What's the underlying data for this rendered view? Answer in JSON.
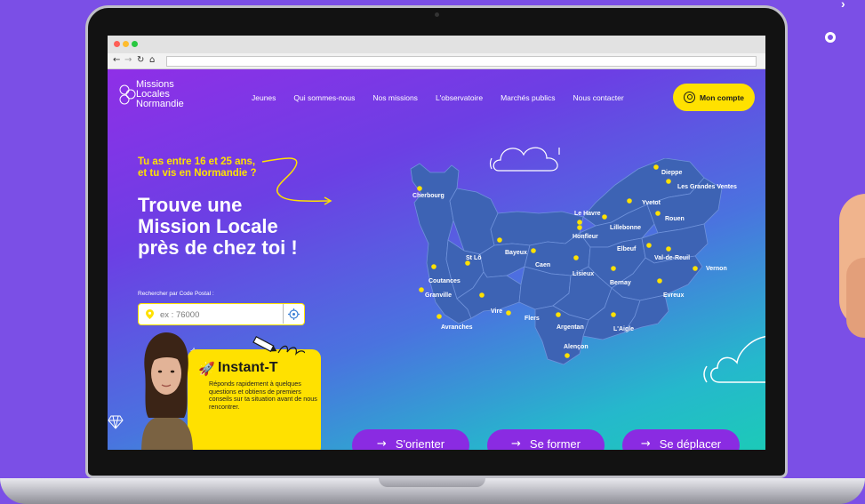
{
  "site": {
    "logo": {
      "lines": [
        "Missions",
        "Locales",
        "Normandie"
      ]
    },
    "menu": [
      "Jeunes",
      "Qui sommes-nous",
      "Nos missions",
      "L'observatoire",
      "Marchés publics",
      "Nous contacter"
    ],
    "account_label": "Mon compte"
  },
  "hero": {
    "intro_lines": [
      "Tu as entre 16 et 25 ans,",
      "et tu vis en Normandie ?"
    ],
    "headline_lines": [
      "Trouve une",
      "Mission Locale",
      "près de chez toi !"
    ]
  },
  "search": {
    "label": "Rechercher par Code Postal :",
    "placeholder": "ex : 76000"
  },
  "instant": {
    "title": "Instant-T",
    "description": "Réponds rapidement à quelques questions et obtiens de premiers conseils sur ta situation avant de nous rencontrer."
  },
  "map_cities": [
    "Cherbourg",
    "Dieppe",
    "Les Grandes Ventes",
    "Yvetot",
    "Le Havre",
    "Rouen",
    "Lillebonne",
    "Honfleur",
    "Elbeuf",
    "Val-de-Reuil",
    "Vernon",
    "Bayeux",
    "St Lô",
    "Caen",
    "Lisieux",
    "Bernay",
    "Coutances",
    "Evreux",
    "Granville",
    "Vire",
    "Flers",
    "Avranches",
    "Argentan",
    "L'Aigle",
    "Alençon"
  ],
  "cta_buttons": [
    "S'orienter",
    "Se former",
    "Se déplacer"
  ],
  "colors": {
    "accent": "#ffe100",
    "purple": "#8a2be2",
    "outer_bg": "#7b4fe6"
  }
}
